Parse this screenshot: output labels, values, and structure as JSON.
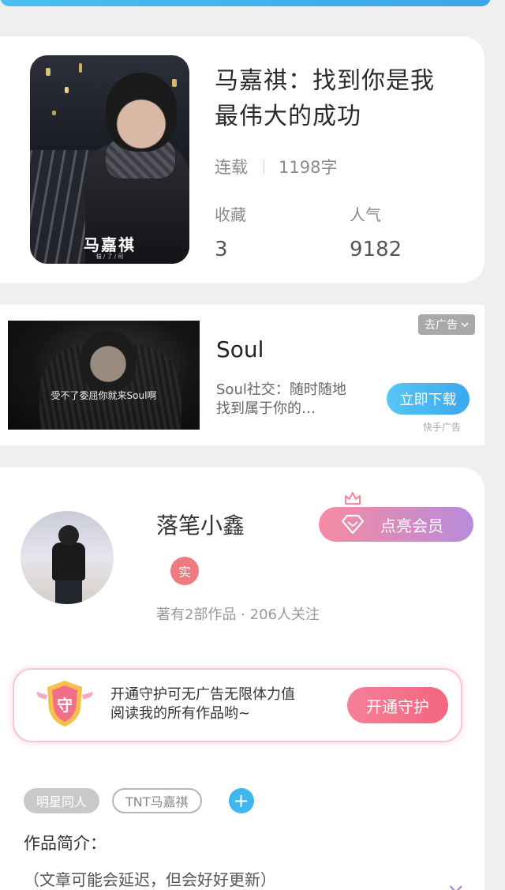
{
  "book": {
    "title": "马嘉祺：找到你是我最伟大的成功",
    "status": "连载",
    "word_count": "1198字",
    "favorites_label": "收藏",
    "favorites_value": "3",
    "popularity_label": "人气",
    "popularity_value": "9182",
    "cover_title": "马嘉祺",
    "cover_sub": "猫 / 了 / 司"
  },
  "ad": {
    "remove_label": "去广告",
    "title": "Soul",
    "description": "Soul社交：随时随地找到属于你的…",
    "download_label": "立即下载",
    "source": "快手广告",
    "image_caption": "受不了委屈你就来Soul啊"
  },
  "author": {
    "name": "落笔小鑫",
    "verified_label": "实",
    "stats": "著有2部作品 · 206人关注",
    "vip_label": "点亮会员"
  },
  "guard": {
    "shield_label": "守",
    "line1": "开通守护可无广告无限体力值",
    "line2": "阅读我的所有作品哟~",
    "button_label": "开通守护"
  },
  "tags": [
    "明星同人",
    "TNT马嘉祺"
  ],
  "add_tag_symbol": "+",
  "intro": {
    "heading": "作品简介：",
    "text": "（文章可能会延迟，但会好好更新）"
  },
  "close_symbol": "×",
  "colors": {
    "accent_blue": "#3aa8ee",
    "accent_pink": "#f2667e",
    "vip_gradient_end": "#b88bdc"
  }
}
